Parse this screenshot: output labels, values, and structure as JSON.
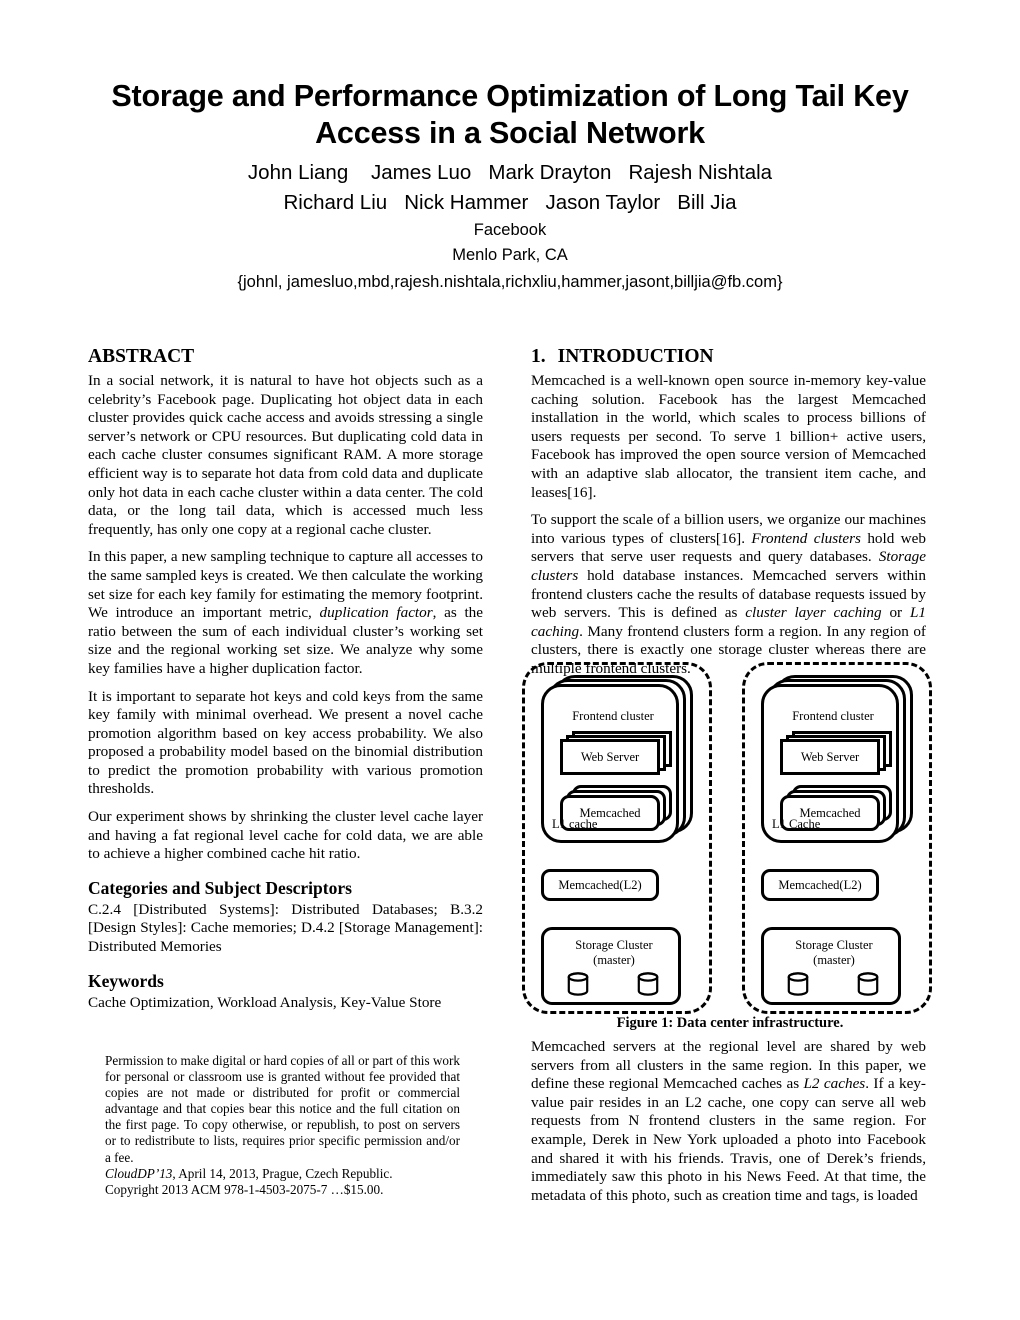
{
  "title": "Storage and Performance Optimization of Long Tail Key Access in a Social Network",
  "authors": {
    "row1": "John Liang    James Luo   Mark Drayton   Rajesh Nishtala",
    "row2": "Richard Liu   Nick Hammer   Jason Taylor   Bill Jia"
  },
  "affiliation": {
    "org": "Facebook",
    "location": "Menlo Park, CA",
    "emails": "{johnl, jamesluo,mbd,rajesh.nishtala,richxliu,hammer,jasont,billjia@fb.com}"
  },
  "abstract": {
    "heading": "ABSTRACT",
    "p1": "In a social network, it is natural to have hot objects such as a celebrity’s Facebook page. Duplicating hot object data in each cluster provides quick cache access and avoids stressing a single server’s network or CPU resources. But duplicating cold data in each cache cluster consumes significant RAM. A more storage efficient way is to separate hot data from cold data and duplicate only hot data in each cache cluster within a data center. The cold data, or the long tail data, which is accessed much less frequently, has only one copy at a regional cache cluster.",
    "p2_a": "In this paper, a new sampling technique to capture all accesses to the same sampled keys is created. We then calculate the working set size for each key family for estimating the memory footprint. We introduce an important metric, ",
    "p2_em": "duplication factor",
    "p2_b": ", as the ratio between the sum of each individual cluster’s working set size and the regional working set size. We analyze why some key families have a higher duplication factor.",
    "p3": "It is important to separate hot keys and cold keys from the same key family with minimal overhead. We present a novel cache promotion algorithm based on key access probability. We also proposed a probability model based on the binomial distribution to predict the promotion probability with various promotion thresholds.",
    "p4": "Our experiment shows by shrinking the cluster level cache layer and having a fat regional level cache for cold data, we are able to achieve a higher combined cache hit ratio."
  },
  "categories": {
    "heading": "Categories and Subject Descriptors",
    "text": "C.2.4 [Distributed Systems]: Distributed Databases; B.3.2 [Design Styles]: Cache memories; D.4.2 [Storage Management]: Distributed Memories"
  },
  "keywords": {
    "heading": "Keywords",
    "text": "Cache Optimization, Workload Analysis, Key-Value Store"
  },
  "copyright": {
    "permission": "Permission to make digital or hard copies of all or part of this work for personal or classroom use is granted without fee provided that copies are not made or distributed for profit or commercial advantage and that copies bear this notice and the full citation on the first page. To copy otherwise, or republish, to post on servers or to redistribute to lists, requires prior specific permission and/or a fee.",
    "conference_name": "CloudDP’13",
    "conference_rest": ", April 14, 2013, Prague, Czech Republic.",
    "copyright_line": "Copyright 2013 ACM 978-1-4503-2075-7 …$15.00."
  },
  "introduction": {
    "number": "1.",
    "heading": "INTRODUCTION",
    "p1": "Memcached is a well-known open source in-memory key-value caching solution. Facebook has the largest Memcached installation in the world, which scales to process billions of users requests per second. To serve 1 billion+ active users, Facebook has improved the open source version of Memcached with an adaptive slab allocator, the transient item cache, and leases[16].",
    "p2_a": "To support the scale of a billion users, we organize our machines into various types of clusters[16]. ",
    "p2_em1": "Frontend clusters",
    "p2_b": " hold web servers that serve user requests and query databases. ",
    "p2_em2": "Storage clusters",
    "p2_c": " hold database instances. Memcached servers within frontend clusters cache the results of database requests issued by web servers. This is defined as ",
    "p2_em3": "cluster layer caching",
    "p2_d": " or ",
    "p2_em4": "L1 caching",
    "p2_e": ". Many frontend clusters form a region. In any region of clusters, there is exactly one storage cluster whereas there are multiple frontend clusters.",
    "p3_a": "Memcached servers at the regional level are shared by web servers from all clusters in the same region. In this paper, we define these regional Memcached caches as ",
    "p3_em": "L2 caches",
    "p3_b": ". If a key-value pair resides in an L2 cache, one copy can serve all web requests from N frontend clusters in the same region. For example, Derek in New York uploaded a photo into Facebook and shared it with his friends. Travis, one of Derek’s friends, immediately saw this photo in his News Feed. At that time, the metadata of this photo, such as creation time and tags, is loaded"
  },
  "figure": {
    "caption": "Figure 1: Data center infrastructure.",
    "regions": [
      {
        "frontend_label": "Frontend cluster",
        "web_server_label": "Web Server",
        "memcached_label": "Memcached",
        "l1_label": "L1 cache",
        "l2_label": "Memcached(L2)",
        "storage_title": "Storage Cluster",
        "storage_sub": "(master)"
      },
      {
        "frontend_label": "Frontend cluster",
        "web_server_label": "Web Server",
        "memcached_label": "Memcached",
        "l1_label": "L1 Cache",
        "l2_label": "Memcached(L2)",
        "storage_title": "Storage Cluster",
        "storage_sub": "(master)"
      }
    ]
  },
  "colors": {
    "ink": "#000000",
    "paper": "#ffffff"
  }
}
